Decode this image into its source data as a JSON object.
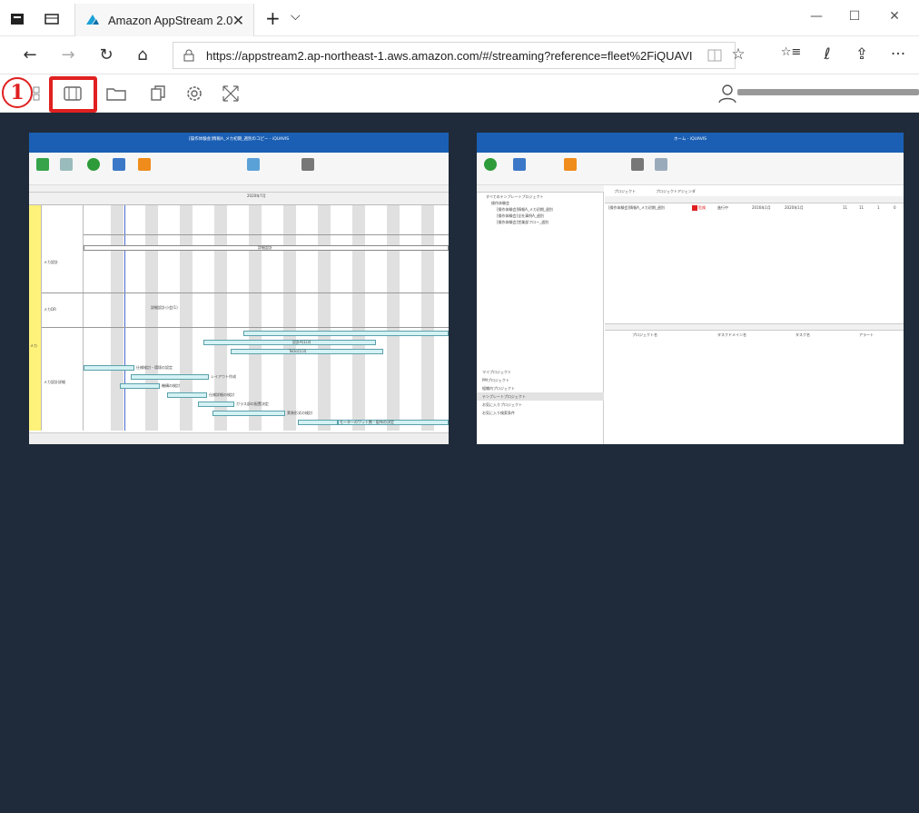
{
  "browser": {
    "tab_title": "Amazon AppStream 2.0",
    "tab_close": "✕",
    "new_tab": "+",
    "tab_list": "⌵",
    "url": "https://appstream2.ap-northeast-1.aws.amazon.com/#/streaming?reference=fleet%2FiQUAVI",
    "window": {
      "minimize": "—",
      "maximize": "☐",
      "close": "✕"
    },
    "nav": {
      "back": "←",
      "forward": "→",
      "refresh": "↻",
      "home": "⌂"
    },
    "right": {
      "favorite": "☆",
      "favorites": "☆≡",
      "pen": "ℓ",
      "share": "⇪",
      "more": "···"
    }
  },
  "appstream_toolbar": {
    "step_marker": "1",
    "icons": [
      "apps-icon",
      "windows-icon",
      "folder-icon",
      "clipboard-icon",
      "settings-icon",
      "fullscreen-icon"
    ]
  },
  "colors": {
    "stream_bg": "#1f2b3a",
    "highlight": "#e02020",
    "app_title": "#1a5fb4",
    "gantt_side": "#fff27a",
    "gantt_bar": "#d4f2f4"
  },
  "left_window": {
    "title": "[操作体験会]情報A_メカ初期_週別のコピー - iQUAVIS",
    "year_label": "2020年7月",
    "rows": [
      "メカ設計",
      "メカDR",
      "メカ",
      "メカ設計詳細"
    ],
    "labels": [
      "詳細設計",
      "詳細設計小会(1)",
      "設計A(1/3)",
      "ToDo(1/3)",
      "仕様検討・環境の設定",
      "レイアウト作成",
      "機構の検討",
      "仕様詳細の検討",
      "ガラス部の配置決定",
      "実装形式の検討",
      "モーターのワット数・配布の決定"
    ]
  },
  "right_window": {
    "title": "ホーム - iQUAVIS",
    "tree": [
      "すべてのテンプレートプロジェクト",
      "操作体験会",
      "[操作体験会]情報A_メカ初期_週別",
      "[操作体験会]全社事例A_週別",
      "[操作体験会]営業部フロー_週別"
    ],
    "nav_items": [
      "マイプロジェクト",
      "PMプロジェクト",
      "組織内プロジェクト",
      "テンプレートプロジェクト",
      "お気に入りプロジェクト",
      "お気に入り検索条件"
    ],
    "tabs": [
      "プロジェクト",
      "プロジェクトアジェンダ"
    ],
    "row": {
      "name": "[操作体験会]情報A_メカ初期_週別",
      "alert": "危険",
      "status": "進行中",
      "start": "2016年1月",
      "end": "2020年1月",
      "n1": "11",
      "n2": "11",
      "n3": "1",
      "n4": "0"
    },
    "task_headers": [
      "プロジェクト名",
      "タスクドメイン名",
      "タスク名",
      "アラート"
    ]
  }
}
